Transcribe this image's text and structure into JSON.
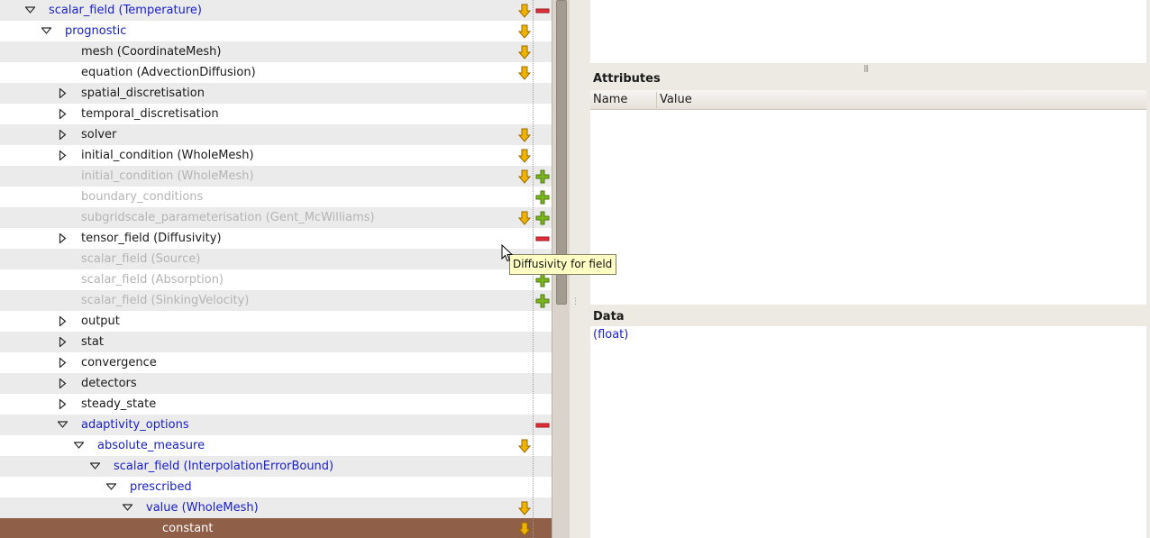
{
  "tree": {
    "rows": [
      {
        "label": "scalar_field (Temperature)",
        "indent": 0,
        "expander": "open",
        "style": "blue",
        "icons": [
          "down-arrow",
          "minus"
        ],
        "alt": true
      },
      {
        "label": "prognostic",
        "indent": 1,
        "expander": "open",
        "style": "blue",
        "icons": [
          "down-arrow"
        ],
        "alt": false
      },
      {
        "label": "mesh (CoordinateMesh)",
        "indent": 2,
        "expander": "none",
        "style": "set",
        "icons": [
          "down-arrow"
        ],
        "alt": true
      },
      {
        "label": "equation (AdvectionDiffusion)",
        "indent": 2,
        "expander": "none",
        "style": "set",
        "icons": [
          "down-arrow"
        ],
        "alt": false
      },
      {
        "label": "spatial_discretisation",
        "indent": 2,
        "expander": "closed",
        "style": "set",
        "icons": [],
        "alt": true
      },
      {
        "label": "temporal_discretisation",
        "indent": 2,
        "expander": "closed",
        "style": "set",
        "icons": [],
        "alt": false
      },
      {
        "label": "solver",
        "indent": 2,
        "expander": "closed",
        "style": "set",
        "icons": [
          "down-arrow"
        ],
        "alt": true
      },
      {
        "label": "initial_condition (WholeMesh)",
        "indent": 2,
        "expander": "closed",
        "style": "set",
        "icons": [
          "down-arrow"
        ],
        "alt": false
      },
      {
        "label": "initial_condition (WholeMesh)",
        "indent": 2,
        "expander": "none",
        "style": "grey",
        "icons": [
          "down-arrow",
          "plus"
        ],
        "alt": true
      },
      {
        "label": "boundary_conditions",
        "indent": 2,
        "expander": "none",
        "style": "grey",
        "icons": [
          "plus"
        ],
        "alt": false
      },
      {
        "label": "subgridscale_parameterisation (Gent_McWilliams)",
        "indent": 2,
        "expander": "none",
        "style": "grey",
        "icons": [
          "down-arrow",
          "plus"
        ],
        "alt": true
      },
      {
        "label": "tensor_field (Diffusivity)",
        "indent": 2,
        "expander": "closed",
        "style": "set",
        "icons": [
          "minus"
        ],
        "alt": false
      },
      {
        "label": "scalar_field (Source)",
        "indent": 2,
        "expander": "none",
        "style": "grey",
        "icons": [],
        "alt": true
      },
      {
        "label": "scalar_field (Absorption)",
        "indent": 2,
        "expander": "none",
        "style": "grey",
        "icons": [
          "plus"
        ],
        "alt": false
      },
      {
        "label": "scalar_field (SinkingVelocity)",
        "indent": 2,
        "expander": "none",
        "style": "grey",
        "icons": [
          "plus"
        ],
        "alt": true
      },
      {
        "label": "output",
        "indent": 2,
        "expander": "closed",
        "style": "set",
        "icons": [],
        "alt": false
      },
      {
        "label": "stat",
        "indent": 2,
        "expander": "closed",
        "style": "set",
        "icons": [],
        "alt": true
      },
      {
        "label": "convergence",
        "indent": 2,
        "expander": "closed",
        "style": "set",
        "icons": [],
        "alt": false
      },
      {
        "label": "detectors",
        "indent": 2,
        "expander": "closed",
        "style": "set",
        "icons": [],
        "alt": true
      },
      {
        "label": "steady_state",
        "indent": 2,
        "expander": "closed",
        "style": "set",
        "icons": [],
        "alt": false
      },
      {
        "label": "adaptivity_options",
        "indent": 2,
        "expander": "open",
        "style": "blue",
        "icons": [
          "minus"
        ],
        "alt": true
      },
      {
        "label": "absolute_measure",
        "indent": 3,
        "expander": "open",
        "style": "blue",
        "icons": [
          "down-arrow"
        ],
        "alt": false
      },
      {
        "label": "scalar_field (InterpolationErrorBound)",
        "indent": 4,
        "expander": "open",
        "style": "blue",
        "icons": [],
        "alt": true
      },
      {
        "label": "prescribed",
        "indent": 5,
        "expander": "open",
        "style": "blue",
        "icons": [],
        "alt": false
      },
      {
        "label": "value (WholeMesh)",
        "indent": 6,
        "expander": "open",
        "style": "blue",
        "icons": [
          "down-arrow"
        ],
        "alt": true
      },
      {
        "label": "constant",
        "indent": 7,
        "expander": "none",
        "style": "selected",
        "icons": [
          "down-arrow"
        ],
        "alt": false,
        "selected": true
      }
    ]
  },
  "tooltip": {
    "text": "Diffusivity for field"
  },
  "attributes": {
    "title": "Attributes",
    "columns": [
      "Name",
      "Value"
    ]
  },
  "data": {
    "title": "Data",
    "value": "(float)"
  },
  "colors": {
    "selection": "#8f5f47",
    "link_blue": "#1a20c8",
    "unset_grey": "#b4b4b4",
    "arrow_orange": "#f0b400",
    "plus_green": "#7ab51d",
    "minus_red": "#e0303a"
  }
}
